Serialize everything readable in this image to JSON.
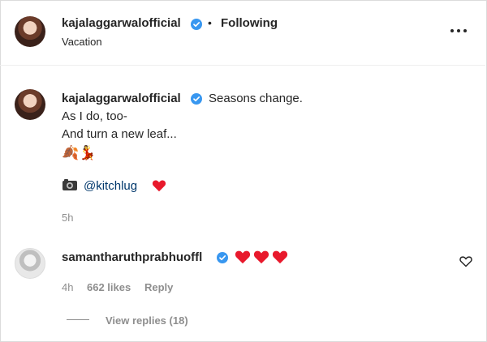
{
  "post": {
    "username": "kajalaggarwalofficial",
    "follow_state": "Following",
    "location": "Vacation"
  },
  "caption": {
    "username": "kajalaggarwalofficial",
    "line1": "Seasons change.",
    "line2": "As I do, too-",
    "line3": "And turn a new leaf...",
    "emojis": "🍂💃",
    "camera_emoji": "📷",
    "mention": "@kitchlug",
    "time": "5h"
  },
  "comment": {
    "username": "samantharuthprabhuoffl",
    "time": "4h",
    "likes": "662 likes",
    "reply": "Reply",
    "view_replies": "View replies (18)"
  },
  "icons": {
    "verified": "verified-badge-icon",
    "more": "more-options-icon",
    "heart": "red-heart-icon",
    "like": "heart-outline-icon",
    "camera": "camera-icon"
  },
  "colors": {
    "verified": "#3897f0",
    "heart": "#e8192c",
    "mention": "#00376b",
    "muted": "#8e8e8e"
  }
}
